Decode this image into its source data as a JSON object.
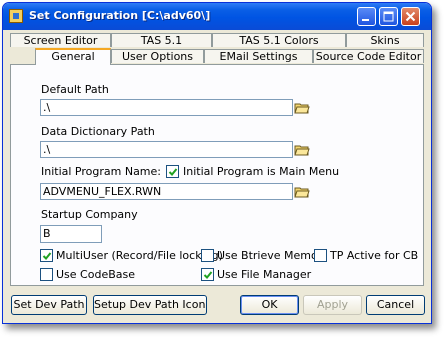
{
  "window": {
    "title": "Set Configuration [C:\\adv60\\]"
  },
  "tabs": {
    "row1": [
      "Screen Editor",
      "TAS 5.1",
      "TAS 5.1 Colors",
      "Skins"
    ],
    "row2": [
      "General",
      "User Options",
      "EMail Settings",
      "Source Code Editor"
    ],
    "selected": "General"
  },
  "general": {
    "default_path": {
      "label": "Default Path",
      "value": ".\\"
    },
    "data_dictionary_path": {
      "label": "Data Dictionary Path",
      "value": ".\\"
    },
    "initial_program": {
      "label": "Initial Program Name:",
      "value": "ADVMENU_FLEX.RWN"
    },
    "initial_is_main_menu": {
      "label": "Initial Program is Main Menu",
      "checked": true
    },
    "startup_company": {
      "label": "Startup Company",
      "value": "B"
    },
    "options": {
      "multiuser": {
        "label": "MultiUser (Record/File locking)",
        "checked": true
      },
      "btrieve": {
        "label": "Use Btrieve Memos",
        "checked": false
      },
      "tp_active": {
        "label": "TP Active for CB",
        "checked": false
      },
      "codebase": {
        "label": "Use CodeBase",
        "checked": false
      },
      "file_manager": {
        "label": "Use File Manager",
        "checked": true
      }
    }
  },
  "buttons": {
    "set_dev_path": "Set Dev Path",
    "setup_dev_path_icons": "Setup Dev Path Icons",
    "ok": "OK",
    "apply": "Apply",
    "cancel": "Cancel"
  },
  "colors": {
    "titlebar": "#0054e3",
    "dialog": "#ece9d8",
    "panel": "#fcfcfe",
    "tab_highlight": "#f5a823"
  },
  "icons": {
    "browse": "browse-folder-icon",
    "minimize": "minimize-icon",
    "maximize": "maximize-icon",
    "close": "close-icon"
  }
}
